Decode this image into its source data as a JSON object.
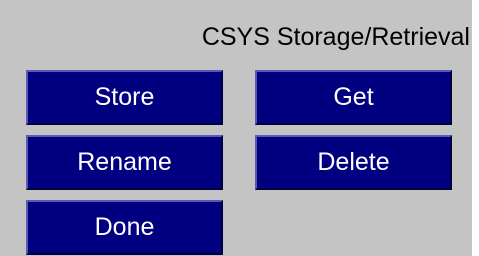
{
  "dialog": {
    "title": "CSYS Storage/Retrieval",
    "buttons": {
      "store": "Store",
      "get": "Get",
      "rename": "Rename",
      "delete": "Delete",
      "done": "Done"
    }
  },
  "colors": {
    "panel_background": "#c4c4c4",
    "button_background": "#000080",
    "button_text": "#ffffff",
    "title_text": "#000000"
  }
}
